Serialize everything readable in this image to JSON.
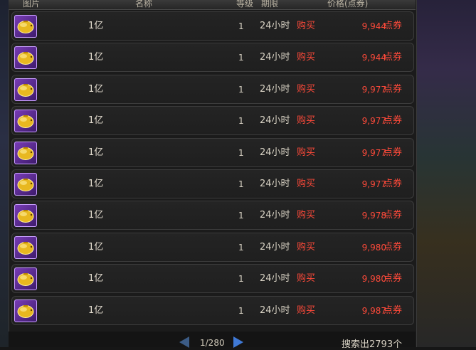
{
  "header": {
    "col_image": "图片",
    "col_name": "名称",
    "col_level": "等级",
    "col_duration": "期限",
    "col_price": "价格(点券)"
  },
  "items": [
    {
      "name": "1亿",
      "level": "1",
      "duration": "24小时",
      "buy": "购买",
      "price": "9,944",
      "unit": "点券",
      "icon": "gold-piggy-icon"
    },
    {
      "name": "1亿",
      "level": "1",
      "duration": "24小时",
      "buy": "购买",
      "price": "9,944",
      "unit": "点券",
      "icon": "gold-piggy-icon"
    },
    {
      "name": "1亿",
      "level": "1",
      "duration": "24小时",
      "buy": "购买",
      "price": "9,977",
      "unit": "点券",
      "icon": "gold-piggy-icon"
    },
    {
      "name": "1亿",
      "level": "1",
      "duration": "24小时",
      "buy": "购买",
      "price": "9,977",
      "unit": "点券",
      "icon": "gold-piggy-icon"
    },
    {
      "name": "1亿",
      "level": "1",
      "duration": "24小时",
      "buy": "购买",
      "price": "9,977",
      "unit": "点券",
      "icon": "gold-piggy-icon"
    },
    {
      "name": "1亿",
      "level": "1",
      "duration": "24小时",
      "buy": "购买",
      "price": "9,977",
      "unit": "点券",
      "icon": "gold-piggy-icon"
    },
    {
      "name": "1亿",
      "level": "1",
      "duration": "24小时",
      "buy": "购买",
      "price": "9,978",
      "unit": "点券",
      "icon": "gold-piggy-icon"
    },
    {
      "name": "1亿",
      "level": "1",
      "duration": "24小时",
      "buy": "购买",
      "price": "9,980",
      "unit": "点券",
      "icon": "gold-piggy-icon"
    },
    {
      "name": "1亿",
      "level": "1",
      "duration": "24小时",
      "buy": "购买",
      "price": "9,980",
      "unit": "点券",
      "icon": "gold-piggy-icon"
    },
    {
      "name": "1亿",
      "level": "1",
      "duration": "24小时",
      "buy": "购买",
      "price": "9,987",
      "unit": "点券",
      "icon": "gold-piggy-icon"
    }
  ],
  "pager": {
    "text": "1/280"
  },
  "search": {
    "count_text": "搜索出2793个"
  },
  "colors": {
    "price": "#ff4a3a",
    "buy": "#ff4a3a",
    "row_bg": "#222222",
    "icon_bg": "#6a34a8"
  }
}
